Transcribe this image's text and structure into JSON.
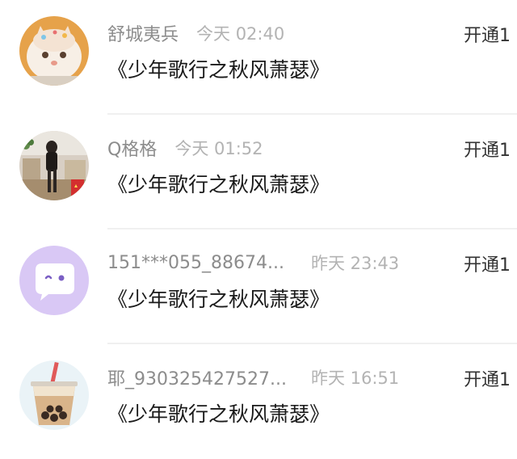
{
  "comments": [
    {
      "username": "舒城夷兵",
      "time": "今天 02:40",
      "message": "《少年歌行之秋风萧瑟》",
      "action_label": "开通1",
      "avatar_icon": "cat-avatar"
    },
    {
      "username": "Q格格",
      "time": "今天 01:52",
      "message": "《少年歌行之秋风萧瑟》",
      "action_label": "开通1",
      "avatar_icon": "person-photo-avatar"
    },
    {
      "username": "151***055_88674...",
      "time": "昨天 23:43",
      "message": "《少年歌行之秋风萧瑟》",
      "action_label": "开通1",
      "avatar_icon": "chat-bubble-avatar",
      "avatar_color": "#d9c8f5"
    },
    {
      "username": "耶_930325427527...",
      "time": "昨天 16:51",
      "message": "《少年歌行之秋风萧瑟》",
      "action_label": "开通1",
      "avatar_icon": "bubble-tea-avatar"
    }
  ]
}
